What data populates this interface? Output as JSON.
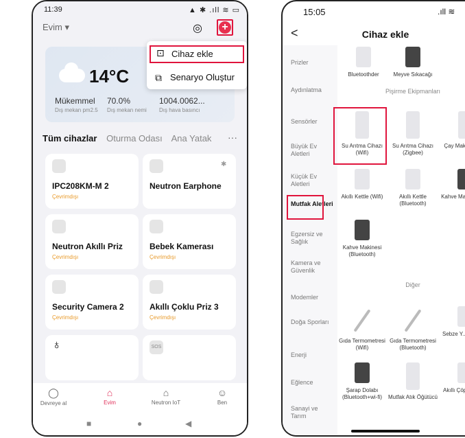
{
  "left": {
    "status": {
      "time": "11:39",
      "status_icons": "▲ ✱ .ıll ≋ ▭"
    },
    "home_title": "Evim ▾",
    "add_button_glyph": "+",
    "weather": {
      "temp": "14°C",
      "stats": [
        {
          "value": "Mükemmel",
          "label": "Dış mekan pm2.5"
        },
        {
          "value": "70.0%",
          "label": "Dış mekan nemi"
        },
        {
          "value": "1004.0062...",
          "label": "Dış hava basıncı"
        }
      ]
    },
    "menu": {
      "add_device": "Cihaz ekle",
      "create_scene": "Senaryo Oluştur"
    },
    "tabs": [
      "Tüm cihazlar",
      "Oturma Odası",
      "Ana Yatak"
    ],
    "tabs_more": "···",
    "devices": [
      {
        "name": "IPC208KM-M 2",
        "status": "Çevrimdışı"
      },
      {
        "name": "Neutron Earphone",
        "status": ""
      },
      {
        "name": "Neutron Akıllı Priz",
        "status": "Çevrimdışı"
      },
      {
        "name": "Bebek Kamerası",
        "status": "Çevrimdışı"
      },
      {
        "name": "Security Camera 2",
        "status": "Çevrimdışı"
      },
      {
        "name": "Akıllı Çoklu Priz 3",
        "status": "Çevrimdışı"
      },
      {
        "name": "",
        "status": ""
      },
      {
        "name": "SOS",
        "status": ""
      }
    ],
    "nav": [
      {
        "label": "Devreye al",
        "glyph": "◯"
      },
      {
        "label": "Evim",
        "glyph": "⌂"
      },
      {
        "label": "Neutron IoT",
        "glyph": "⌂"
      },
      {
        "label": "Ben",
        "glyph": "☺"
      }
    ],
    "sysnav": [
      "■",
      "●",
      "◀"
    ]
  },
  "right": {
    "status": {
      "time": "15:05",
      "status_icons": ".ıll ≋"
    },
    "back_glyph": "<",
    "title": "Cihaz ekle",
    "scan_glyph": "◎",
    "categories": [
      "Prizler",
      "Aydınlatma",
      "Sensörler",
      "Büyük Ev Aletleri",
      "Küçük Ev Aletleri",
      "Mutfak Aletleri",
      "Egzersiz ve Sağlık",
      "Kamera ve Güvenlik",
      "Modemler",
      "Doğa Sporları",
      "Enerji",
      "Eğlence",
      "Sanayi ve Tarım"
    ],
    "section_kitchen": "Pişirme Ekipmanları",
    "section_other": "Diğer",
    "top_items": [
      "Bluetoothder",
      "Meyve Sıkacağı"
    ],
    "kitchen_items": [
      "Su Arıtma Cihazı (Wifi)",
      "Su Arıtma Cihazı (Zigbee)",
      "Çay Mak... (Wif...",
      "Akıllı Kettle (Wifi)",
      "Akıllı Kettle (Bluetooth)",
      "Kahve Mak... (Wif...",
      "Kahve Makinesi (Bluetooth)"
    ],
    "other_items": [
      "Gıda Termometresi (Wifi)",
      "Gıda Termometresi (Bluetooth)",
      "Sebze Y... Makin...",
      "Şarap Dolabı (Bluetooth+wi-fi)",
      "Mutfak Atık Öğütücü",
      "Akıllı Çöp... (Wif..."
    ]
  }
}
